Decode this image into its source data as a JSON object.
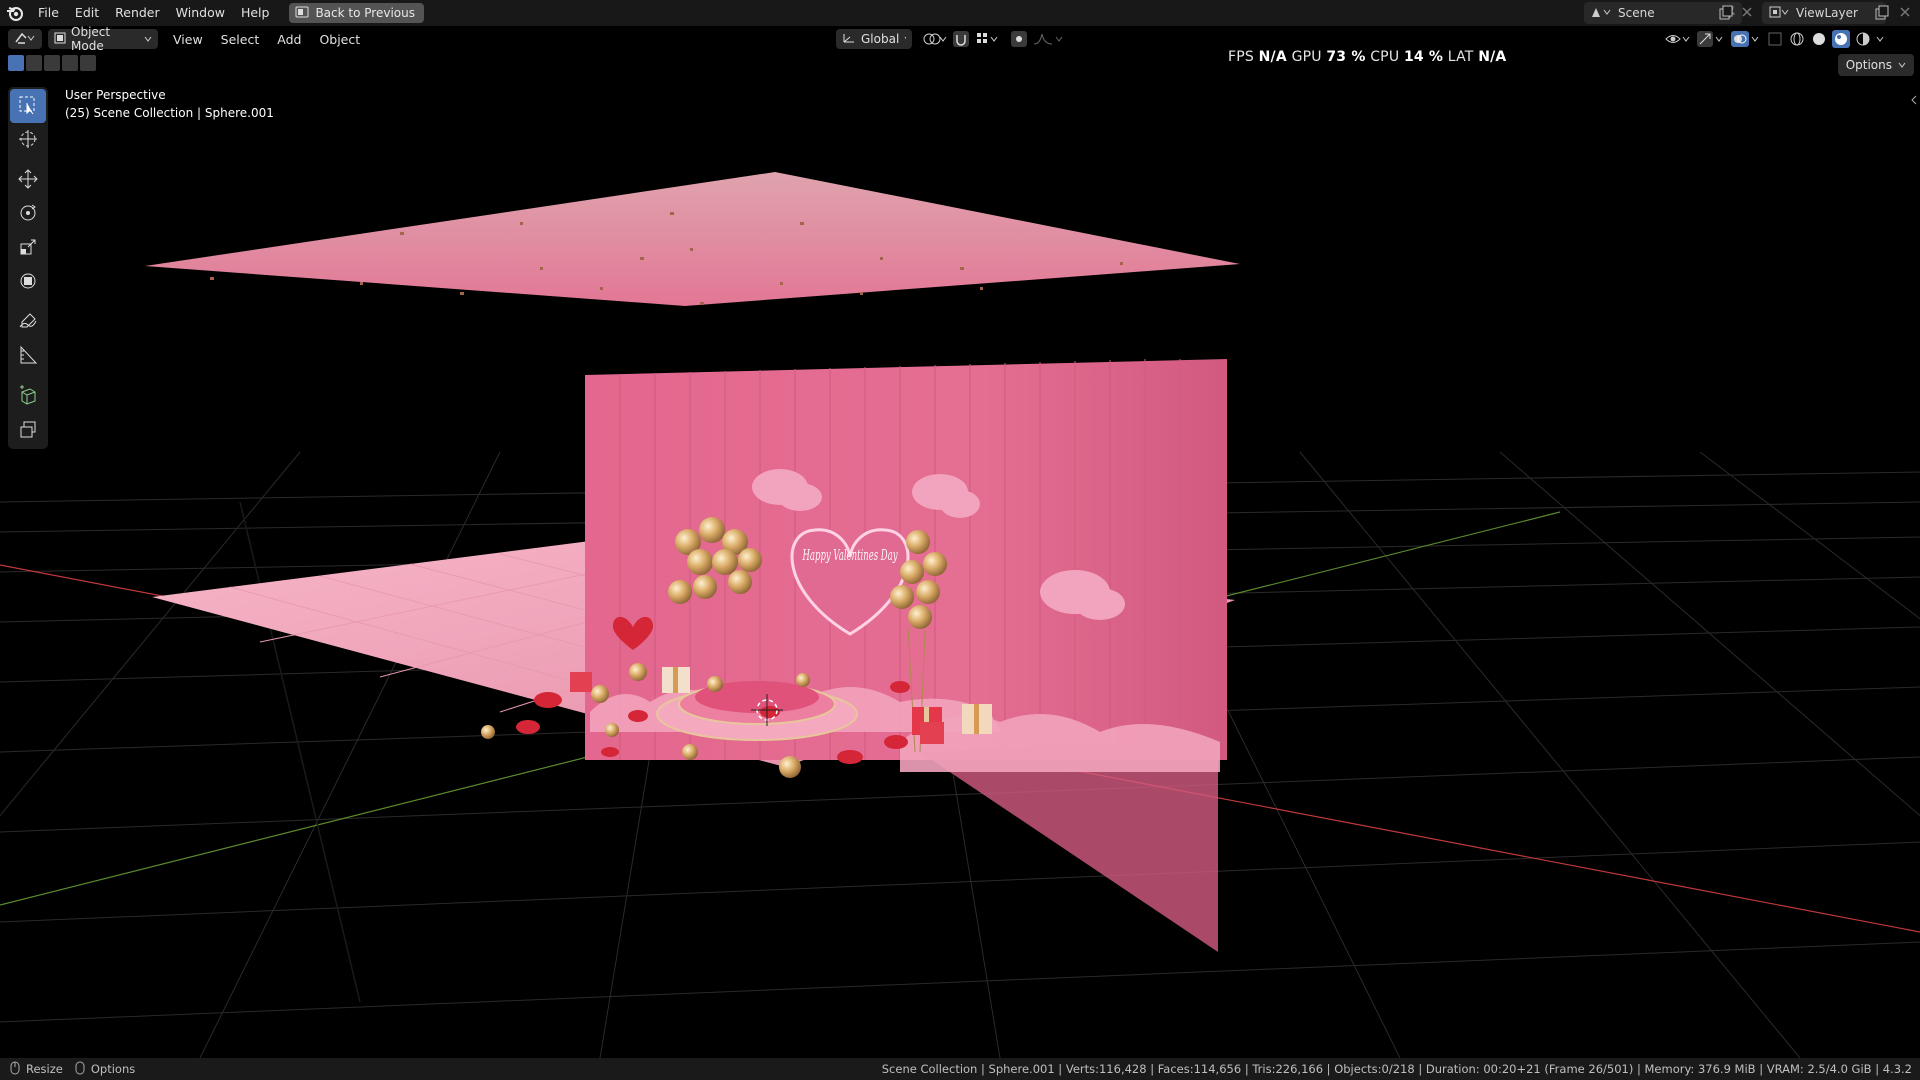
{
  "menu": {
    "file": "File",
    "edit": "Edit",
    "render": "Render",
    "window": "Window",
    "help": "Help",
    "back_button": "Back to Previous"
  },
  "scene": {
    "name": "Scene",
    "view_layer": "ViewLayer"
  },
  "header": {
    "mode": "Object Mode",
    "view": "View",
    "select": "Select",
    "add": "Add",
    "object": "Object",
    "orientation": "Global",
    "options": "Options"
  },
  "perf": {
    "fps_label": "FPS",
    "fps_value": "N/A",
    "gpu_label": "GPU",
    "gpu_value": "73 %",
    "cpu_label": "CPU",
    "cpu_value": "14 %",
    "lat_label": "LAT",
    "lat_value": "N/A"
  },
  "viewport": {
    "perspective": "User Perspective",
    "collection": "(25) Scene Collection | Sphere.001",
    "neon_text": "Happy Valentines Day"
  },
  "status": {
    "resize": "Resize",
    "options": "Options",
    "stats": "Scene Collection | Sphere.001 | Verts:116,428 | Faces:114,656 | Tris:226,166 | Objects:0/218 | Duration: 00:20+21 (Frame 26/501) | Memory: 376.9 MiB | VRAM: 2.5/4.0 GiB | 4.3.2"
  },
  "colors": {
    "accent": "#4772b3",
    "wall": "#e0628a",
    "floor": "#f09ab2",
    "x_axis": "#c0383c",
    "y_axis": "#5c8a2c"
  },
  "icons": [
    "blender-logo-icon",
    "back-icon",
    "scene-icon",
    "pin-icon",
    "copy-icon",
    "close-icon",
    "viewlayer-icon",
    "editor-type-icon",
    "object-mode-icon",
    "orientation-icon",
    "pivot-icon",
    "snap-icon",
    "proportional-icon",
    "visibility-icon",
    "gizmo-icon",
    "overlay-icon",
    "xray-icon",
    "wireframe-shading-icon",
    "solid-shading-icon",
    "material-shading-icon",
    "rendered-shading-icon",
    "select-box-icon",
    "cursor-icon",
    "move-icon",
    "rotate-icon",
    "scale-icon",
    "transform-icon",
    "annotate-icon",
    "measure-icon",
    "add-cube-icon",
    "extrude-icon",
    "mouse-icon"
  ]
}
